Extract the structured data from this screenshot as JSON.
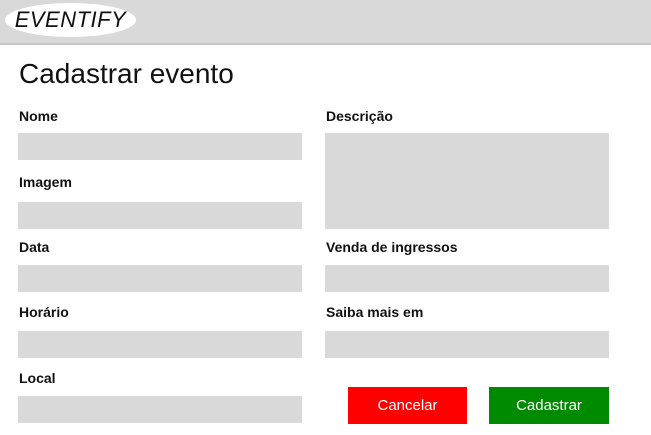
{
  "header": {
    "logo_text": "EVENTIFY"
  },
  "page": {
    "title": "Cadastrar evento"
  },
  "form": {
    "nome": {
      "label": "Nome",
      "value": ""
    },
    "imagem": {
      "label": "Imagem",
      "value": ""
    },
    "data": {
      "label": "Data",
      "value": ""
    },
    "horario": {
      "label": "Horário",
      "value": ""
    },
    "local": {
      "label": "Local",
      "value": ""
    },
    "descricao": {
      "label": "Descrição",
      "value": ""
    },
    "venda_ingressos": {
      "label": "Venda de ingressos",
      "value": ""
    },
    "saiba_mais": {
      "label": "Saiba mais em",
      "value": ""
    }
  },
  "actions": {
    "cancel_label": "Cancelar",
    "submit_label": "Cadastrar"
  },
  "colors": {
    "cancel": "#ff0000",
    "submit": "#008a00",
    "field_bg": "#d9d9d9",
    "header_bg": "#d9d9d9"
  }
}
